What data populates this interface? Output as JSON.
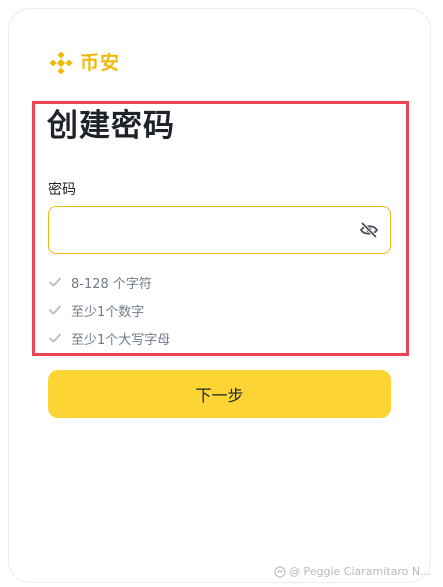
{
  "brand": {
    "name": "币安",
    "color": "#F0B90B",
    "logo_icon": "binance-diamond-icon"
  },
  "page": {
    "title": "创建密码"
  },
  "password_field": {
    "label": "密码",
    "value": "",
    "placeholder": "",
    "toggle_icon": "eye-slash-icon"
  },
  "requirements": [
    {
      "text": "8-128 个字符",
      "icon": "check-icon"
    },
    {
      "text": "至少1个数字",
      "icon": "check-icon"
    },
    {
      "text": "至少1个大写字母",
      "icon": "check-icon"
    }
  ],
  "buttons": {
    "next_label": "下一步",
    "next_color": "#FCD535"
  },
  "annotation": {
    "highlight_color": "#ec4452"
  },
  "watermark": {
    "text": "@ Peggie Ciaramitaro N...",
    "icon": "share-icon"
  }
}
